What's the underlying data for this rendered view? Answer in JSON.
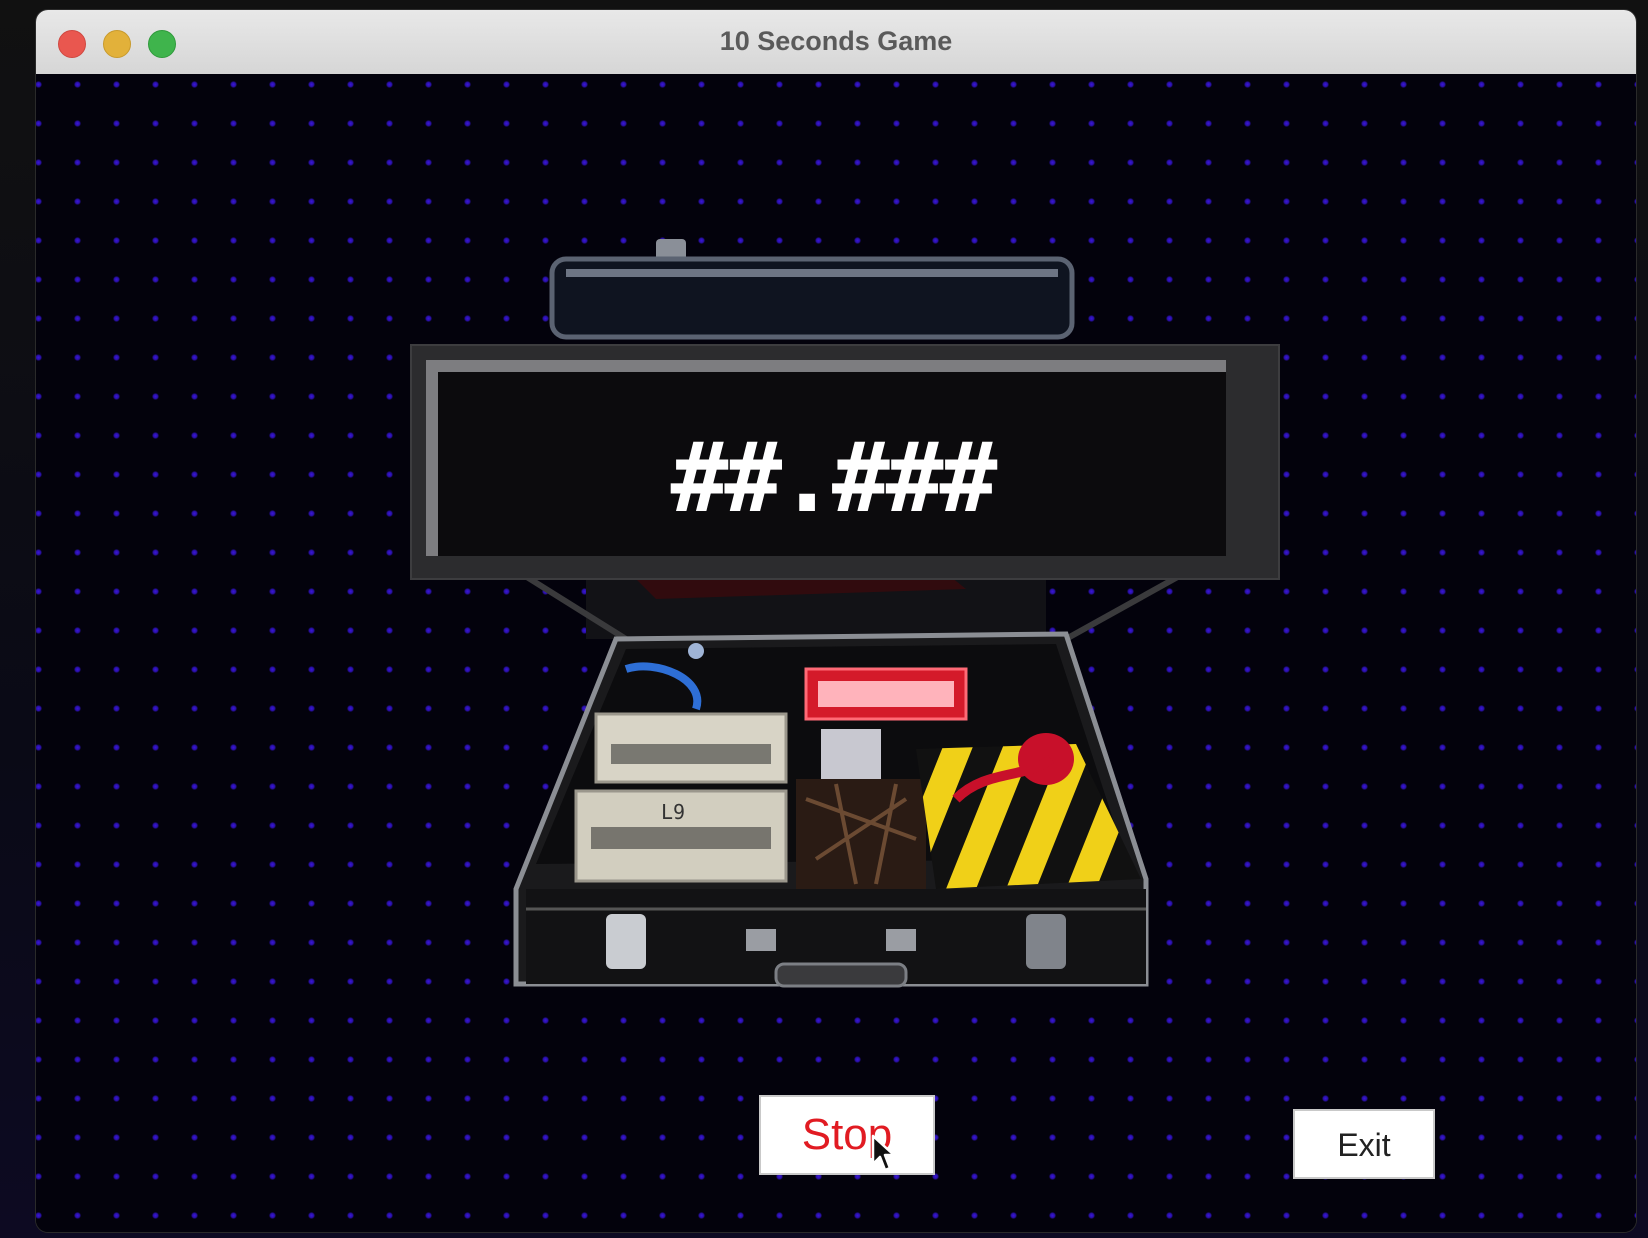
{
  "window": {
    "title": "10 Seconds Game"
  },
  "display": {
    "timer_text": "##.###"
  },
  "controls": {
    "stop_label": "Stop",
    "exit_label": "Exit"
  },
  "icons": {
    "close": "close-icon",
    "minimize": "minimize-icon",
    "zoom": "zoom-icon",
    "cursor": "cursor-icon"
  },
  "colors": {
    "background": "#03020c",
    "dot": "#2a10a8",
    "stop_text": "#e11b22",
    "lcd_text": "#ffffff"
  }
}
